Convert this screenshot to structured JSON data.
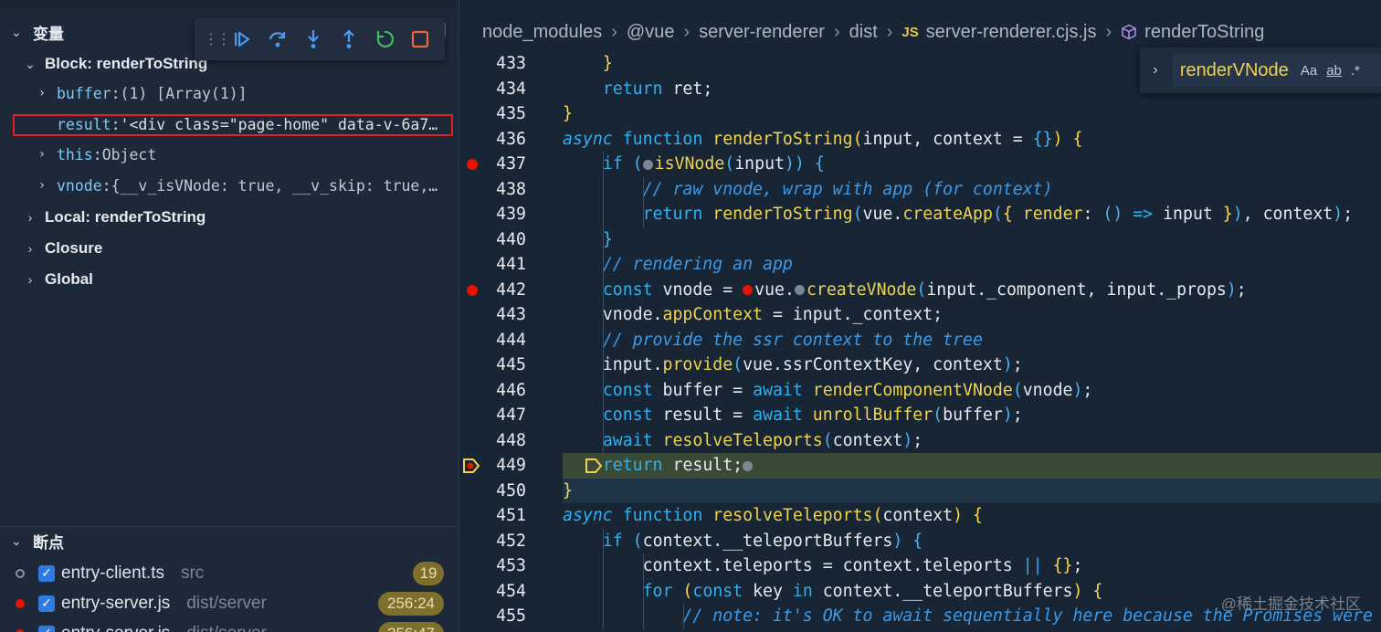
{
  "variables_panel": {
    "title": "变量",
    "block_scope": {
      "label": "Block: renderToString",
      "vars": [
        {
          "name": "buffer",
          "value": "(1) [Array(1)]",
          "expandable": true
        },
        {
          "name": "result",
          "value": "'<div class=\"page-home\" data-v-6a7…",
          "expandable": false
        },
        {
          "name": "this",
          "value": "Object",
          "expandable": true
        },
        {
          "name": "vnode",
          "value": "{__v_isVNode: true, __v_skip: true,…",
          "expandable": true
        }
      ]
    },
    "scopes": [
      "Local: renderToString",
      "Closure",
      "Global"
    ],
    "close_bracket": "]"
  },
  "debug_toolbar": {
    "buttons": [
      "continue",
      "step-over",
      "step-into",
      "step-out",
      "restart",
      "stop"
    ]
  },
  "breakpoints_panel": {
    "title": "断点",
    "items": [
      {
        "file": "entry-client.ts",
        "path": "src",
        "badge": "19",
        "dot": "hollow"
      },
      {
        "file": "entry-server.js",
        "path": "dist/server",
        "badge": "256:24",
        "dot": "red"
      },
      {
        "file": "entry-server.js",
        "path": "dist/server",
        "badge": "256:47",
        "dot": "red"
      }
    ]
  },
  "breadcrumb": {
    "parts": [
      "node_modules",
      "@vue",
      "server-renderer",
      "dist"
    ],
    "file_icon": "JS",
    "file": "server-renderer.cjs.js",
    "symbol": "renderToString"
  },
  "find_widget": {
    "query": "renderVNode",
    "opt_case": "Aa",
    "opt_word": "ab",
    "opt_regex": ".*"
  },
  "code": {
    "lines": [
      {
        "n": "433",
        "bp": false,
        "html": "    <span class='p'>}</span>"
      },
      {
        "n": "434",
        "bp": false,
        "html": "    <span class='k'>return</span> ret;"
      },
      {
        "n": "435",
        "bp": false,
        "html": "<span class='p'>}</span>"
      },
      {
        "n": "436",
        "bp": false,
        "html": "<span class='ki'>async</span> <span class='k'>function</span> <span class='f'>renderToString</span><span class='p'>(</span>input, context = <span class='pb'>{}</span><span class='p'>)</span> <span class='p'>{</span>"
      },
      {
        "n": "437",
        "bp": true,
        "html": "    <span class='k'>if</span> <span class='pb'>(</span><span class='inlinebp-grey'></span><span class='f'>isVNode</span><span class='pb'>(</span>input<span class='pb'>))</span> <span class='pb'>{</span>"
      },
      {
        "n": "438",
        "bp": false,
        "html": "        <span class='c'>// raw vnode, wrap with app (for context)</span>"
      },
      {
        "n": "439",
        "bp": false,
        "html": "        <span class='k'>return</span> <span class='f'>renderToString</span><span class='pb'>(</span>vue.<span class='f'>createApp</span><span class='pb'>(</span><span class='p'>{</span> <span class='f'>render</span>: <span class='pb'>()</span> <span class='k'>=&gt;</span> input <span class='p'>}</span><span class='pb'>)</span>, context<span class='pb'>)</span>;"
      },
      {
        "n": "440",
        "bp": false,
        "html": "    <span class='pb'>}</span>"
      },
      {
        "n": "441",
        "bp": false,
        "html": "    <span class='c'>// rendering an app</span>"
      },
      {
        "n": "442",
        "bp": true,
        "html": "    <span class='k'>const</span> vnode = <span class='inlinebp-red'></span>vue.<span class='inlinebp-grey'></span><span class='f'>createVNode</span><span class='pb'>(</span>input._component, input._props<span class='pb'>)</span>;"
      },
      {
        "n": "443",
        "bp": false,
        "html": "    vnode.<span class='f'>appContext</span> = input._context;"
      },
      {
        "n": "444",
        "bp": false,
        "html": "    <span class='c'>// provide the ssr context to the tree</span>"
      },
      {
        "n": "445",
        "bp": false,
        "html": "    input.<span class='f'>provide</span><span class='pb'>(</span>vue.ssrContextKey, context<span class='pb'>)</span>;"
      },
      {
        "n": "446",
        "bp": false,
        "html": "    <span class='k'>const</span> buffer = <span class='k'>await</span> <span class='f'>renderComponentVNode</span><span class='pb'>(</span>vnode<span class='pb'>)</span>;"
      },
      {
        "n": "447",
        "bp": false,
        "html": "    <span class='k'>const</span> result = <span class='k'>await</span> <span class='f'>unrollBuffer</span><span class='pb'>(</span>buffer<span class='pb'>)</span>;"
      },
      {
        "n": "448",
        "bp": false,
        "html": "    <span class='k'>await</span> <span class='f'>resolveTeleports</span><span class='pb'>(</span>context<span class='pb'>)</span>;"
      },
      {
        "n": "449",
        "bp": false,
        "current": true,
        "html": "    <span class='k'>return</span> result;<span class='inlinebp-grey'></span>"
      },
      {
        "n": "450",
        "bp": false,
        "cursor": true,
        "html": "<span class='p'>}</span>"
      },
      {
        "n": "451",
        "bp": false,
        "html": "<span class='ki'>async</span> <span class='k'>function</span> <span class='f'>resolveTeleports</span><span class='p'>(</span>context<span class='p'>)</span> <span class='p'>{</span>"
      },
      {
        "n": "452",
        "bp": false,
        "html": "    <span class='k'>if</span> <span class='pb'>(</span>context.__teleportBuffers<span class='pb'>)</span> <span class='pb'>{</span>"
      },
      {
        "n": "453",
        "bp": false,
        "html": "        context.teleports = context.teleports <span class='k'>||</span> <span class='p'>{}</span>;"
      },
      {
        "n": "454",
        "bp": false,
        "html": "        <span class='k'>for</span> <span class='p'>(</span><span class='k'>const</span> key <span class='k'>in</span> context.__teleportBuffers<span class='p'>)</span> <span class='p'>{</span>"
      },
      {
        "n": "455",
        "bp": false,
        "html": "            <span class='c'>// note: it's OK to await sequentially here because the Promises were</span>"
      }
    ]
  },
  "watermark": "@稀土掘金技术社区"
}
